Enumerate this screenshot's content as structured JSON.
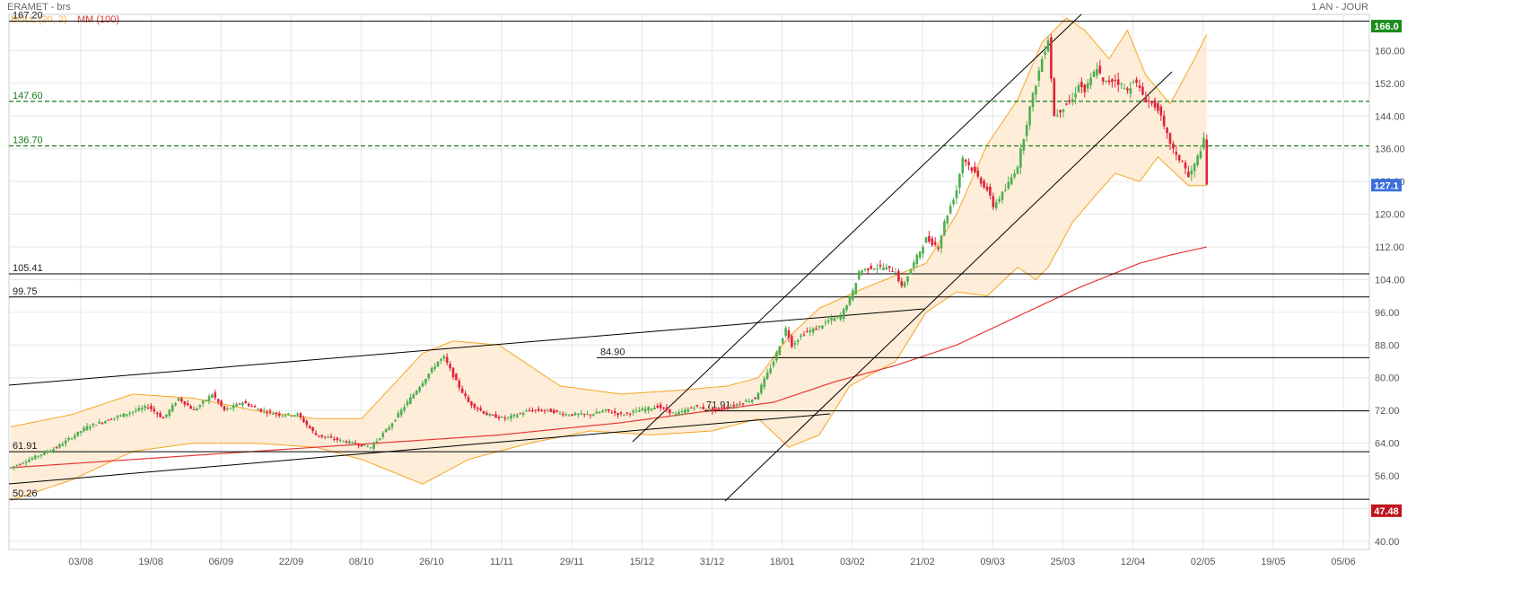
{
  "header": {
    "title": "ERAMET - brs",
    "period": "1 AN - JOUR",
    "legend_boll": "BOLL (20, 2)",
    "legend_mm": "MM (100)"
  },
  "colors": {
    "up": "#4caf50",
    "down": "#e0223a",
    "mm": "#e53935",
    "boll_line": "#f5a623",
    "boll_fill": "#fde9cf",
    "support": "#000000",
    "dashed": "#1a7a1a",
    "badge_top": "#1a8c1a",
    "badge_last": "#3b6fdc",
    "badge_low": "#c0141e"
  },
  "chart_data": {
    "type": "candlestick",
    "title": "ERAMET - brs",
    "period": "1 AN - JOUR",
    "x_tick_labels": [
      "03/08",
      "19/08",
      "06/09",
      "22/09",
      "08/10",
      "26/10",
      "11/11",
      "29/11",
      "15/12",
      "31/12",
      "18/01",
      "03/02",
      "21/02",
      "09/03",
      "25/03",
      "12/04",
      "02/05",
      "19/05",
      "05/06"
    ],
    "y_tick_labels": [
      "40.00",
      "48.00",
      "56.00",
      "64.00",
      "72.00",
      "80.00",
      "88.00",
      "96.00",
      "104.00",
      "112.00",
      "120.00",
      "128.00",
      "136.00",
      "144.00",
      "152.00",
      "160.00"
    ],
    "ylim": [
      38,
      168
    ],
    "levels": {
      "horizontal": [
        "167.20",
        "105.41",
        "99.75",
        "84.90",
        "71.91",
        "61.91",
        "50.26"
      ],
      "dashed": [
        "147.60",
        "136.70"
      ]
    },
    "badges": {
      "top": "166.0",
      "last": "127.1",
      "low": "47.48"
    },
    "indicators": {
      "bollinger": "BOLL (20, 2)",
      "moving_average": "MM (100)"
    },
    "series_anchors": {
      "close": [
        [
          0,
          58
        ],
        [
          15,
          63
        ],
        [
          25,
          68
        ],
        [
          45,
          73
        ],
        [
          50,
          70
        ],
        [
          55,
          75
        ],
        [
          60,
          72
        ],
        [
          66,
          76
        ],
        [
          70,
          72
        ],
        [
          76,
          74
        ],
        [
          82,
          72
        ],
        [
          88,
          71
        ],
        [
          94,
          71
        ],
        [
          100,
          66
        ],
        [
          106,
          65
        ],
        [
          112,
          64
        ],
        [
          118,
          63
        ],
        [
          124,
          68
        ],
        [
          130,
          74
        ],
        [
          136,
          80
        ],
        [
          140,
          84
        ],
        [
          142,
          85
        ],
        [
          146,
          79
        ],
        [
          150,
          74
        ],
        [
          156,
          71
        ],
        [
          162,
          70
        ],
        [
          170,
          72
        ],
        [
          176,
          72
        ],
        [
          182,
          71
        ],
        [
          186,
          71
        ],
        [
          190,
          71
        ],
        [
          195,
          72
        ],
        [
          200,
          71
        ],
        [
          206,
          72
        ],
        [
          212,
          73
        ],
        [
          218,
          71
        ],
        [
          224,
          73
        ],
        [
          230,
          72
        ],
        [
          236,
          73
        ],
        [
          240,
          74
        ],
        [
          244,
          75
        ],
        [
          250,
          84
        ],
        [
          254,
          92
        ],
        [
          256,
          88
        ],
        [
          260,
          91
        ],
        [
          264,
          92
        ],
        [
          268,
          94
        ],
        [
          272,
          95
        ],
        [
          276,
          101
        ],
        [
          278,
          106
        ],
        [
          282,
          107
        ],
        [
          286,
          107
        ],
        [
          290,
          106
        ],
        [
          292,
          102
        ],
        [
          296,
          108
        ],
        [
          300,
          114
        ],
        [
          304,
          112
        ],
        [
          306,
          118
        ],
        [
          310,
          126
        ],
        [
          312,
          134
        ],
        [
          316,
          130
        ],
        [
          320,
          126
        ],
        [
          322,
          122
        ],
        [
          326,
          126
        ],
        [
          330,
          132
        ],
        [
          334,
          146
        ],
        [
          338,
          158
        ],
        [
          340,
          163
        ],
        [
          342,
          144
        ],
        [
          346,
          147
        ],
        [
          348,
          148
        ],
        [
          350,
          152
        ],
        [
          352,
          150
        ],
        [
          356,
          156
        ],
        [
          358,
          152
        ],
        [
          362,
          153
        ],
        [
          366,
          150
        ],
        [
          368,
          153
        ],
        [
          372,
          148
        ],
        [
          376,
          146
        ],
        [
          378,
          141
        ],
        [
          382,
          134
        ],
        [
          384,
          133
        ],
        [
          386,
          129
        ],
        [
          388,
          132
        ],
        [
          391,
          138
        ],
        [
          392,
          127.1
        ]
      ],
      "mm": [
        [
          0,
          58
        ],
        [
          40,
          60
        ],
        [
          80,
          62
        ],
        [
          120,
          64
        ],
        [
          160,
          66
        ],
        [
          200,
          69
        ],
        [
          230,
          72
        ],
        [
          250,
          74
        ],
        [
          270,
          79
        ],
        [
          290,
          83
        ],
        [
          310,
          88
        ],
        [
          330,
          95
        ],
        [
          350,
          102
        ],
        [
          370,
          108
        ],
        [
          380,
          110
        ],
        [
          392,
          112
        ]
      ],
      "boll_upper": [
        [
          0,
          68
        ],
        [
          20,
          71
        ],
        [
          40,
          76
        ],
        [
          60,
          75
        ],
        [
          80,
          72
        ],
        [
          100,
          70
        ],
        [
          115,
          70
        ],
        [
          125,
          78
        ],
        [
          135,
          86
        ],
        [
          145,
          89
        ],
        [
          160,
          88
        ],
        [
          180,
          78
        ],
        [
          200,
          76
        ],
        [
          220,
          77
        ],
        [
          235,
          78
        ],
        [
          245,
          80
        ],
        [
          255,
          90
        ],
        [
          265,
          97
        ],
        [
          280,
          102
        ],
        [
          300,
          108
        ],
        [
          310,
          120
        ],
        [
          320,
          137
        ],
        [
          330,
          148
        ],
        [
          338,
          162
        ],
        [
          346,
          168
        ],
        [
          352,
          165
        ],
        [
          360,
          158
        ],
        [
          366,
          165
        ],
        [
          372,
          154
        ],
        [
          380,
          147
        ],
        [
          388,
          158
        ],
        [
          392,
          164
        ]
      ],
      "boll_lower": [
        [
          0,
          50
        ],
        [
          20,
          55
        ],
        [
          40,
          62
        ],
        [
          60,
          64
        ],
        [
          80,
          64
        ],
        [
          100,
          63
        ],
        [
          115,
          60
        ],
        [
          125,
          57
        ],
        [
          135,
          54
        ],
        [
          150,
          60
        ],
        [
          170,
          64
        ],
        [
          190,
          67
        ],
        [
          210,
          66
        ],
        [
          230,
          67
        ],
        [
          245,
          70
        ],
        [
          255,
          63
        ],
        [
          265,
          66
        ],
        [
          275,
          78
        ],
        [
          290,
          84
        ],
        [
          300,
          96
        ],
        [
          310,
          101
        ],
        [
          320,
          100
        ],
        [
          330,
          107
        ],
        [
          336,
          104
        ],
        [
          340,
          107
        ],
        [
          348,
          118
        ],
        [
          356,
          125
        ],
        [
          362,
          130
        ],
        [
          370,
          128
        ],
        [
          376,
          134
        ],
        [
          386,
          127
        ],
        [
          392,
          127
        ]
      ]
    }
  }
}
